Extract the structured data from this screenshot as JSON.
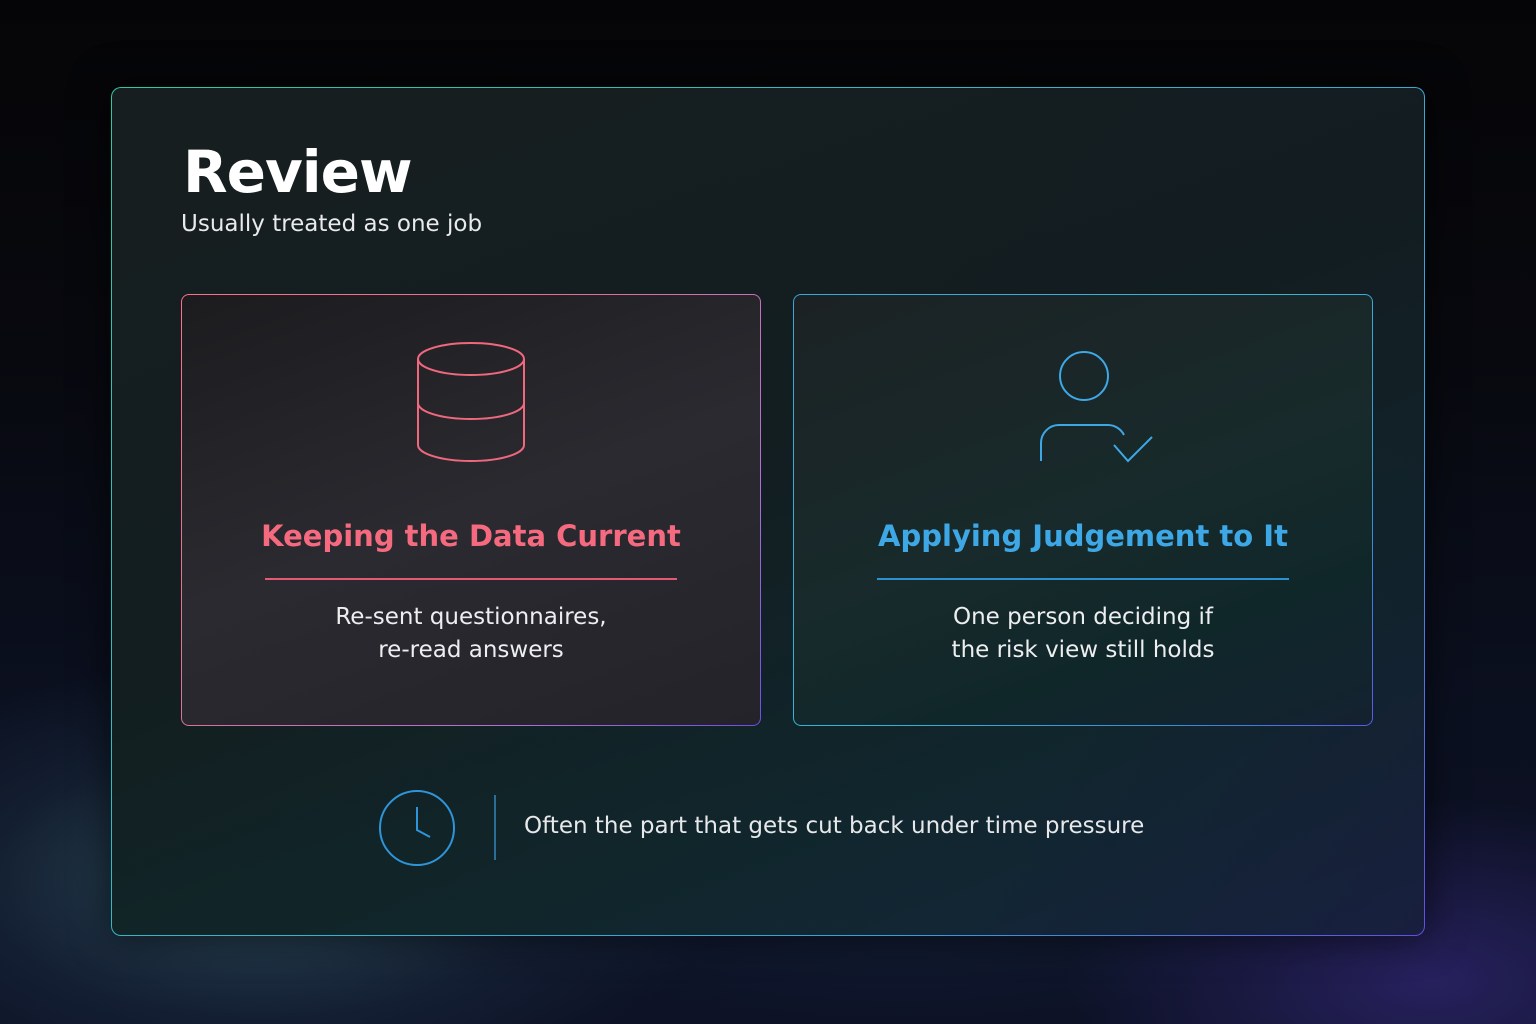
{
  "header": {
    "title": "Review",
    "subtitle": "Usually treated as one job"
  },
  "cards": [
    {
      "icon": "database-icon",
      "title": "Keeping the Data Current",
      "description_lines": [
        "Re-sent questionnaires,",
        "re-read answers"
      ],
      "accent": "#f66a80"
    },
    {
      "icon": "user-check-icon",
      "title": "Applying Judgement to It",
      "description_lines": [
        "One person deciding if",
        "the risk view still holds"
      ],
      "accent": "#3ea8e6"
    }
  ],
  "footer": {
    "icon": "clock-icon",
    "text": "Often the part that gets cut back under time pressure"
  },
  "colors": {
    "panel_border_start": "#2fc8a4",
    "panel_border_end": "#6050e0",
    "divider": "#2a6f98"
  }
}
